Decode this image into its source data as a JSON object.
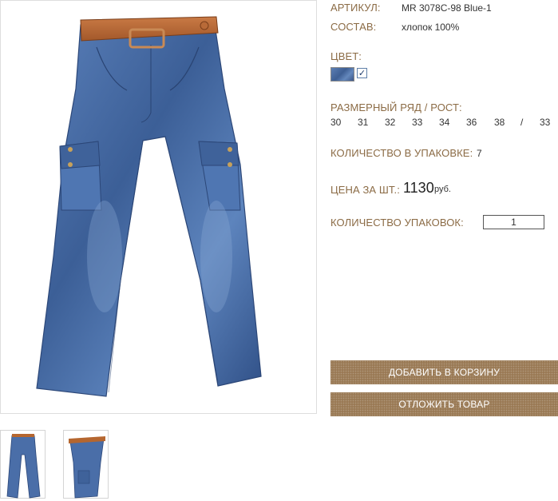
{
  "product": {
    "article_label": "АРТИКУЛ:",
    "article_value": "MR 3078C-98 Blue-1",
    "composition_label": "СОСТАВ:",
    "composition_value": "хлопок 100%",
    "color_label": "ЦВЕТ:",
    "color_check": "✓",
    "size_label": "РАЗМЕРНЫЙ РЯД / РОСТ:",
    "sizes": [
      "30",
      "31",
      "32",
      "33",
      "34",
      "36",
      "38",
      "/",
      "33"
    ],
    "pack_qty_label": "КОЛИЧЕСТВО В УПАКОВКЕ:",
    "pack_qty_value": "7",
    "price_label": "ЦЕНА ЗА ШТ.:",
    "price_value": "1130",
    "price_unit": "руб.",
    "packs_label": "КОЛИЧЕСТВО УПАКОВОК:",
    "packs_value": "1"
  },
  "buttons": {
    "add_to_cart": "ДОБАВИТЬ В КОРЗИНУ",
    "save_item": "ОТЛОЖИТЬ ТОВАР"
  },
  "icons": {
    "main_image": "jeans-photo-icon",
    "thumb_front": "jeans-front-thumbnail-icon",
    "thumb_side": "jeans-side-thumbnail-icon"
  },
  "colors": {
    "label": "#8b6b45",
    "button": "#9a7a55",
    "denim": "#4a6ea8"
  }
}
